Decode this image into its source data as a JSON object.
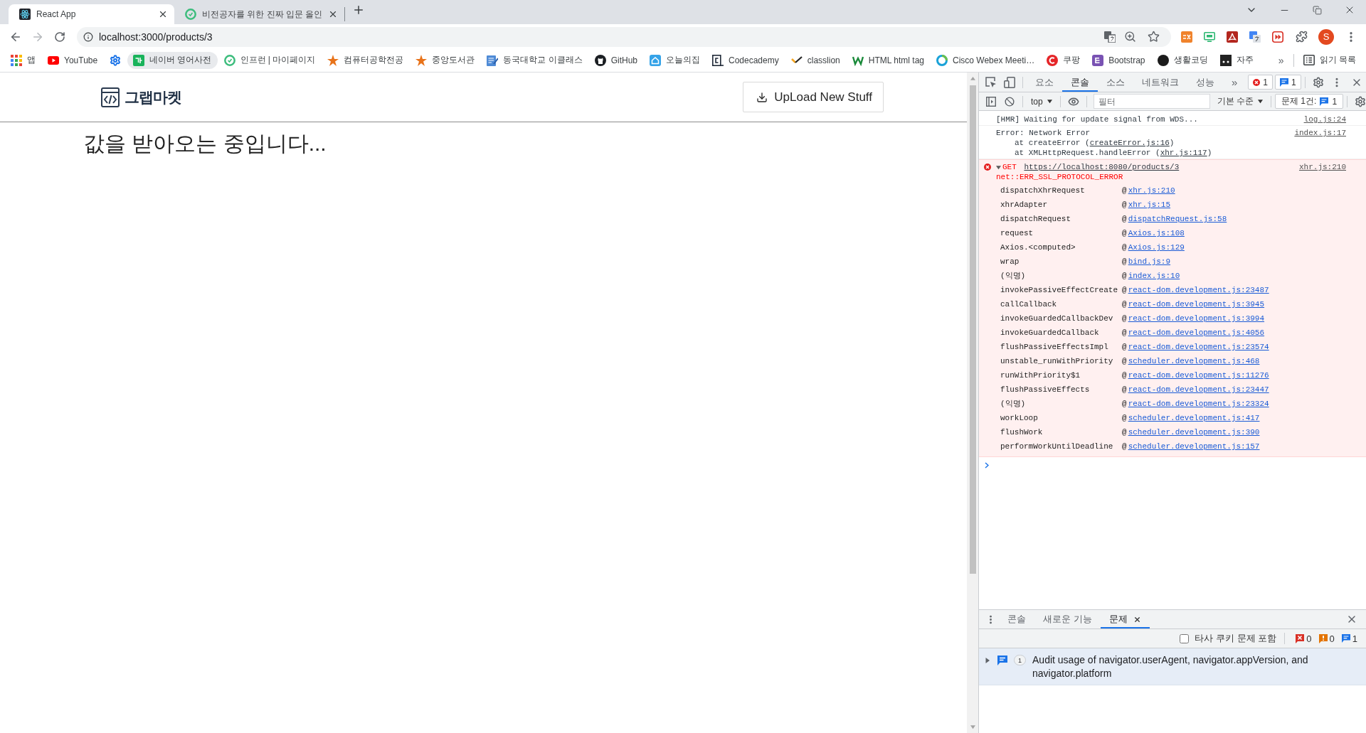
{
  "browser": {
    "tabs": [
      {
        "title": "React App",
        "selected": true
      },
      {
        "title": "비전공자를 위한 진짜 입문 올인",
        "selected": false
      }
    ],
    "address": "localhost:3000/products/3",
    "profile_initial": "S",
    "bookmarks": [
      {
        "label": "앱",
        "hovered": false
      },
      {
        "label": "YouTube",
        "hovered": false
      },
      {
        "hovered": false
      },
      {
        "label": "네이버 영어사전",
        "hovered": true
      },
      {
        "label": "인프런 | 마이페이지",
        "hovered": false
      },
      {
        "label": "컴퓨터공학전공",
        "hovered": false
      },
      {
        "label": "중앙도서관",
        "hovered": false
      },
      {
        "label": "동국대학교 이클래스",
        "hovered": false
      },
      {
        "label": "GitHub",
        "hovered": false
      },
      {
        "label": "오늘의집",
        "hovered": false
      },
      {
        "label": "Codecademy",
        "hovered": false
      },
      {
        "label": "classlion",
        "hovered": false
      },
      {
        "label": "HTML html tag",
        "hovered": false
      },
      {
        "label": "Cisco Webex Meeti…",
        "hovered": false
      },
      {
        "label": "쿠팡",
        "hovered": false
      },
      {
        "label": "Bootstrap",
        "hovered": false
      },
      {
        "label": "생활코딩",
        "hovered": false
      },
      {
        "label": "자주",
        "hovered": false
      }
    ],
    "bookmarks_more": "»",
    "reading_list": "읽기 목록"
  },
  "page": {
    "logo": "그랩마켓",
    "upload_button": "UpLoad New Stuff",
    "loading_text": "값을 받아오는 중입니다..."
  },
  "devtools": {
    "tabs": [
      {
        "label": "요소",
        "selected": false
      },
      {
        "label": "콘솔",
        "selected": true
      },
      {
        "label": "소스",
        "selected": false
      },
      {
        "label": "네트워크",
        "selected": false
      },
      {
        "label": "성능",
        "selected": false
      }
    ],
    "more_tabs": "»",
    "error_count": "1",
    "issue_count": "1",
    "console_toolbar": {
      "context": "top",
      "filter_placeholder": "필터",
      "levels": "기본 수준",
      "issues_label": "문제 1건:",
      "issues_count": "1"
    },
    "messages": [
      {
        "kind": "info",
        "text": "[HMR] Waiting for update signal from WDS...",
        "source": "log.js:24"
      },
      {
        "kind": "trace",
        "text": "Error: Network Error",
        "source": "index.js:17",
        "frames": [
          {
            "before": "at createError (",
            "link": "createError.js:16",
            "after": ")"
          },
          {
            "before": "at XMLHttpRequest.handleError (",
            "link": "xhr.js:117",
            "after": ")"
          }
        ]
      },
      {
        "kind": "error",
        "expanded": true,
        "method": "GET",
        "url": "https://localhost:8080/products/3",
        "detail": "net::ERR_SSL_PROTOCOL_ERROR",
        "source": "xhr.js:210",
        "stack": [
          {
            "function": "dispatchXhrRequest",
            "at": "@",
            "link": "xhr.js:210"
          },
          {
            "function": "xhrAdapter",
            "at": "@",
            "link": "xhr.js:15"
          },
          {
            "function": "dispatchRequest",
            "at": "@",
            "link": "dispatchRequest.js:58"
          },
          {
            "function": "request",
            "at": "@",
            "link": "Axios.js:108"
          },
          {
            "function": "Axios.<computed>",
            "at": "@",
            "link": "Axios.js:129"
          },
          {
            "function": "wrap",
            "at": "@",
            "link": "bind.js:9"
          },
          {
            "function": "(익명)",
            "at": "@",
            "link": "index.js:10"
          },
          {
            "function": "invokePassiveEffectCreate",
            "at": "@",
            "link": "react-dom.development.js:23487"
          },
          {
            "function": "callCallback",
            "at": "@",
            "link": "react-dom.development.js:3945"
          },
          {
            "function": "invokeGuardedCallbackDev",
            "at": "@",
            "link": "react-dom.development.js:3994"
          },
          {
            "function": "invokeGuardedCallback",
            "at": "@",
            "link": "react-dom.development.js:4056"
          },
          {
            "function": "flushPassiveEffectsImpl",
            "at": "@",
            "link": "react-dom.development.js:23574"
          },
          {
            "function": "unstable_runWithPriority",
            "at": "@",
            "link": "scheduler.development.js:468"
          },
          {
            "function": "runWithPriority$1",
            "at": "@",
            "link": "react-dom.development.js:11276"
          },
          {
            "function": "flushPassiveEffects",
            "at": "@",
            "link": "react-dom.development.js:23447"
          },
          {
            "function": "(익명)",
            "at": "@",
            "link": "react-dom.development.js:23324"
          },
          {
            "function": "workLoop",
            "at": "@",
            "link": "scheduler.development.js:417"
          },
          {
            "function": "flushWork",
            "at": "@",
            "link": "scheduler.development.js:390"
          },
          {
            "function": "performWorkUntilDeadline",
            "at": "@",
            "link": "scheduler.development.js:157"
          }
        ]
      }
    ],
    "drawer": {
      "tabs": [
        {
          "label": "콘솔",
          "selected": false,
          "closable": false
        },
        {
          "label": "새로운 기능",
          "selected": false,
          "closable": false
        },
        {
          "label": "문제",
          "selected": true,
          "closable": true
        }
      ],
      "third_party_cookies": {
        "label": "타사 쿠키 문제 포함",
        "checked": false
      },
      "counts": [
        {
          "kind": "error",
          "count": "0"
        },
        {
          "kind": "warning",
          "count": "0"
        },
        {
          "kind": "info",
          "count": "1"
        }
      ],
      "issues": [
        {
          "count": "1",
          "text": "Audit usage of navigator.userAgent, navigator.appVersion, and navigator.platform",
          "expanded": false
        }
      ]
    }
  }
}
